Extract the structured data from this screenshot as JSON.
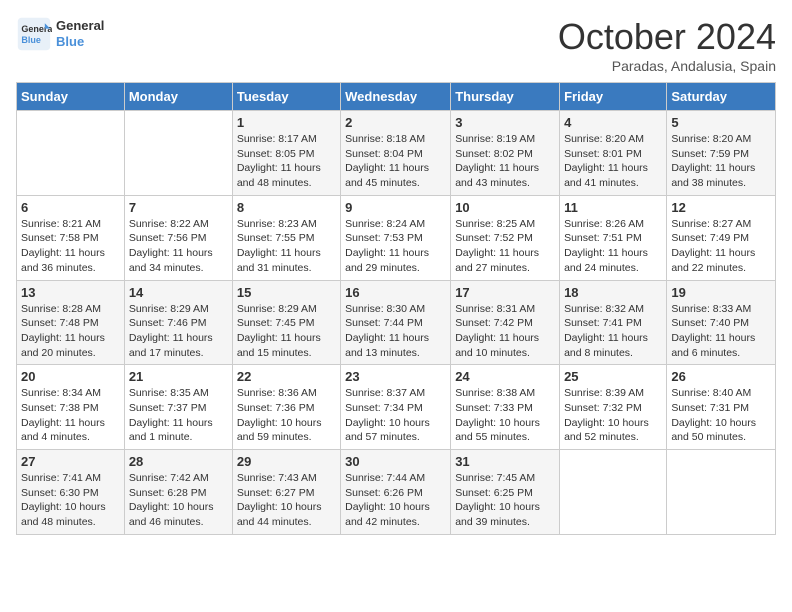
{
  "header": {
    "logo_line1": "General",
    "logo_line2": "Blue",
    "month": "October 2024",
    "location": "Paradas, Andalusia, Spain"
  },
  "weekdays": [
    "Sunday",
    "Monday",
    "Tuesday",
    "Wednesday",
    "Thursday",
    "Friday",
    "Saturday"
  ],
  "weeks": [
    [
      {
        "day": "",
        "info": ""
      },
      {
        "day": "",
        "info": ""
      },
      {
        "day": "1",
        "info": "Sunrise: 8:17 AM\nSunset: 8:05 PM\nDaylight: 11 hours and 48 minutes."
      },
      {
        "day": "2",
        "info": "Sunrise: 8:18 AM\nSunset: 8:04 PM\nDaylight: 11 hours and 45 minutes."
      },
      {
        "day": "3",
        "info": "Sunrise: 8:19 AM\nSunset: 8:02 PM\nDaylight: 11 hours and 43 minutes."
      },
      {
        "day": "4",
        "info": "Sunrise: 8:20 AM\nSunset: 8:01 PM\nDaylight: 11 hours and 41 minutes."
      },
      {
        "day": "5",
        "info": "Sunrise: 8:20 AM\nSunset: 7:59 PM\nDaylight: 11 hours and 38 minutes."
      }
    ],
    [
      {
        "day": "6",
        "info": "Sunrise: 8:21 AM\nSunset: 7:58 PM\nDaylight: 11 hours and 36 minutes."
      },
      {
        "day": "7",
        "info": "Sunrise: 8:22 AM\nSunset: 7:56 PM\nDaylight: 11 hours and 34 minutes."
      },
      {
        "day": "8",
        "info": "Sunrise: 8:23 AM\nSunset: 7:55 PM\nDaylight: 11 hours and 31 minutes."
      },
      {
        "day": "9",
        "info": "Sunrise: 8:24 AM\nSunset: 7:53 PM\nDaylight: 11 hours and 29 minutes."
      },
      {
        "day": "10",
        "info": "Sunrise: 8:25 AM\nSunset: 7:52 PM\nDaylight: 11 hours and 27 minutes."
      },
      {
        "day": "11",
        "info": "Sunrise: 8:26 AM\nSunset: 7:51 PM\nDaylight: 11 hours and 24 minutes."
      },
      {
        "day": "12",
        "info": "Sunrise: 8:27 AM\nSunset: 7:49 PM\nDaylight: 11 hours and 22 minutes."
      }
    ],
    [
      {
        "day": "13",
        "info": "Sunrise: 8:28 AM\nSunset: 7:48 PM\nDaylight: 11 hours and 20 minutes."
      },
      {
        "day": "14",
        "info": "Sunrise: 8:29 AM\nSunset: 7:46 PM\nDaylight: 11 hours and 17 minutes."
      },
      {
        "day": "15",
        "info": "Sunrise: 8:29 AM\nSunset: 7:45 PM\nDaylight: 11 hours and 15 minutes."
      },
      {
        "day": "16",
        "info": "Sunrise: 8:30 AM\nSunset: 7:44 PM\nDaylight: 11 hours and 13 minutes."
      },
      {
        "day": "17",
        "info": "Sunrise: 8:31 AM\nSunset: 7:42 PM\nDaylight: 11 hours and 10 minutes."
      },
      {
        "day": "18",
        "info": "Sunrise: 8:32 AM\nSunset: 7:41 PM\nDaylight: 11 hours and 8 minutes."
      },
      {
        "day": "19",
        "info": "Sunrise: 8:33 AM\nSunset: 7:40 PM\nDaylight: 11 hours and 6 minutes."
      }
    ],
    [
      {
        "day": "20",
        "info": "Sunrise: 8:34 AM\nSunset: 7:38 PM\nDaylight: 11 hours and 4 minutes."
      },
      {
        "day": "21",
        "info": "Sunrise: 8:35 AM\nSunset: 7:37 PM\nDaylight: 11 hours and 1 minute."
      },
      {
        "day": "22",
        "info": "Sunrise: 8:36 AM\nSunset: 7:36 PM\nDaylight: 10 hours and 59 minutes."
      },
      {
        "day": "23",
        "info": "Sunrise: 8:37 AM\nSunset: 7:34 PM\nDaylight: 10 hours and 57 minutes."
      },
      {
        "day": "24",
        "info": "Sunrise: 8:38 AM\nSunset: 7:33 PM\nDaylight: 10 hours and 55 minutes."
      },
      {
        "day": "25",
        "info": "Sunrise: 8:39 AM\nSunset: 7:32 PM\nDaylight: 10 hours and 52 minutes."
      },
      {
        "day": "26",
        "info": "Sunrise: 8:40 AM\nSunset: 7:31 PM\nDaylight: 10 hours and 50 minutes."
      }
    ],
    [
      {
        "day": "27",
        "info": "Sunrise: 7:41 AM\nSunset: 6:30 PM\nDaylight: 10 hours and 48 minutes."
      },
      {
        "day": "28",
        "info": "Sunrise: 7:42 AM\nSunset: 6:28 PM\nDaylight: 10 hours and 46 minutes."
      },
      {
        "day": "29",
        "info": "Sunrise: 7:43 AM\nSunset: 6:27 PM\nDaylight: 10 hours and 44 minutes."
      },
      {
        "day": "30",
        "info": "Sunrise: 7:44 AM\nSunset: 6:26 PM\nDaylight: 10 hours and 42 minutes."
      },
      {
        "day": "31",
        "info": "Sunrise: 7:45 AM\nSunset: 6:25 PM\nDaylight: 10 hours and 39 minutes."
      },
      {
        "day": "",
        "info": ""
      },
      {
        "day": "",
        "info": ""
      }
    ]
  ]
}
